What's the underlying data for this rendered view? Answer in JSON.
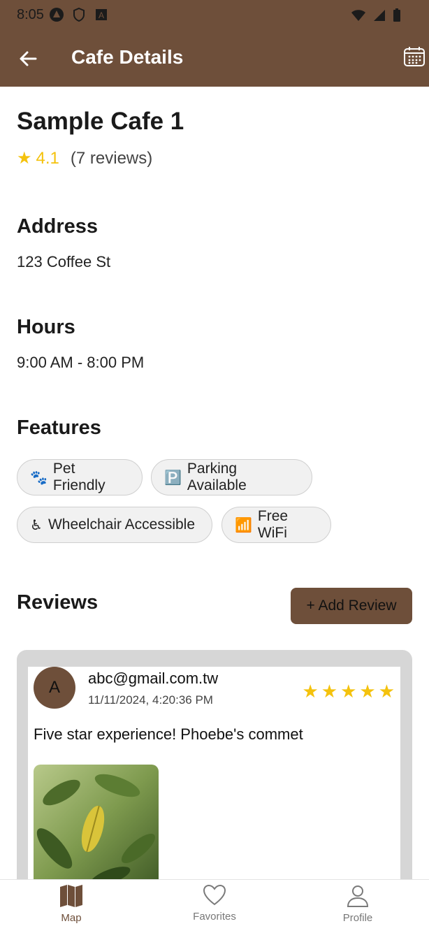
{
  "status_bar": {
    "time": "8:05"
  },
  "app_bar": {
    "title": "Cafe Details"
  },
  "cafe": {
    "name": "Sample Cafe 1",
    "rating": "4.1",
    "review_count": "(7 reviews)"
  },
  "address": {
    "title": "Address",
    "value": "123 Coffee St"
  },
  "hours": {
    "title": "Hours",
    "value": "9:00 AM - 8:00 PM"
  },
  "features": {
    "title": "Features",
    "items": [
      {
        "icon": "paw-icon",
        "glyph": "🐾",
        "label": "Pet Friendly"
      },
      {
        "icon": "parking-icon",
        "glyph": "🅿️",
        "label": "Parking Available"
      },
      {
        "icon": "wheelchair-icon",
        "glyph": "♿",
        "label": "Wheelchair Accessible"
      },
      {
        "icon": "wifi-icon",
        "glyph": "📶",
        "label": "Free WiFi"
      }
    ]
  },
  "reviews": {
    "title": "Reviews",
    "add_label": "+ Add Review",
    "items": [
      {
        "avatar_letter": "A",
        "email": "abc@gmail.com.tw",
        "date": "11/11/2024, 4:20:36 PM",
        "stars": 5,
        "text": "Five star experience! Phoebe's commet"
      }
    ]
  },
  "bottom_nav": {
    "items": [
      {
        "label": "Map",
        "icon": "map-icon",
        "active": true
      },
      {
        "label": "Favorites",
        "icon": "heart-icon",
        "active": false
      },
      {
        "label": "Profile",
        "icon": "person-icon",
        "active": false
      }
    ]
  },
  "colors": {
    "brand": "#6e4f3a",
    "star": "#f4c20d"
  }
}
